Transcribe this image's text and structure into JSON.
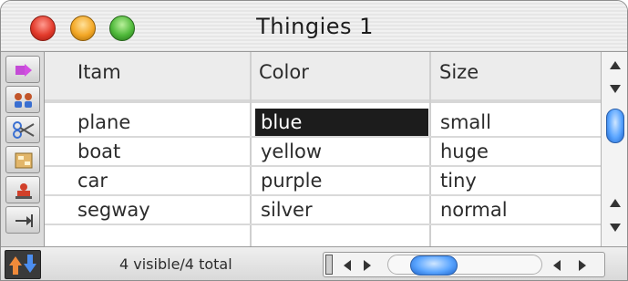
{
  "window": {
    "title": "Thingies 1"
  },
  "toolbar": {
    "tools": [
      {
        "icon": "pointer-icon"
      },
      {
        "icon": "people-icon"
      },
      {
        "icon": "scissors-icon"
      },
      {
        "icon": "form-icon"
      },
      {
        "icon": "stamp-icon"
      },
      {
        "icon": "arrow-right-icon"
      },
      {
        "icon": "sort-updown-icon"
      }
    ]
  },
  "table": {
    "columns": [
      "Itam",
      "Color",
      "Size"
    ],
    "rows": [
      {
        "item": "plane",
        "color": "blue",
        "size": "small",
        "selected_col": "color"
      },
      {
        "item": "boat",
        "color": "yellow",
        "size": "huge"
      },
      {
        "item": "car",
        "color": "purple",
        "size": "tiny"
      },
      {
        "item": "segway",
        "color": "silver",
        "size": "normal"
      }
    ]
  },
  "status": {
    "text": "4 visible/4 total"
  },
  "colors": {
    "selection": "#1c1c1c",
    "accent_blue": "#5aa5ff"
  }
}
